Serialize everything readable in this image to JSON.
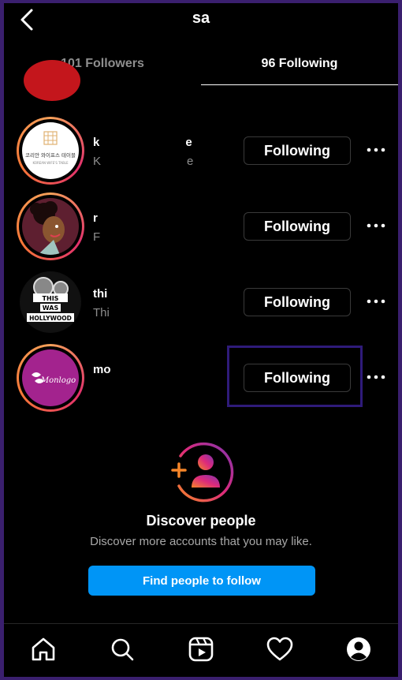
{
  "header": {
    "title": "sa"
  },
  "tabs": [
    {
      "label": "101 Followers",
      "active": false
    },
    {
      "label": "96 Following",
      "active": true
    }
  ],
  "list": [
    {
      "username": "k",
      "username_tail": "e",
      "fullname": "K",
      "fullname_tail": "e",
      "avatar_text_ko": "코리안 와이프스 테이블",
      "avatar_text_en": "KOREAN WIFE'S TABLE",
      "button": "Following"
    },
    {
      "username": "r",
      "fullname": "F",
      "button": "Following"
    },
    {
      "username": "thi",
      "fullname": "Thi",
      "avatar_text": [
        "THIS",
        "WAS",
        "HOLLYWOOD"
      ],
      "button": "Following"
    },
    {
      "username": "mo",
      "fullname": "",
      "avatar_text": "Monlogo",
      "button": "Following"
    }
  ],
  "discover": {
    "title": "Discover people",
    "subtitle": "Discover more accounts that you may like.",
    "button": "Find people to follow"
  },
  "bottom_nav": [
    "home-icon",
    "search-icon",
    "reels-icon",
    "heart-icon",
    "profile-icon"
  ],
  "colors": {
    "accent": "#0095f6",
    "background": "#000000",
    "highlight": "#2f1b7a",
    "muted": "#8e8e8e"
  }
}
